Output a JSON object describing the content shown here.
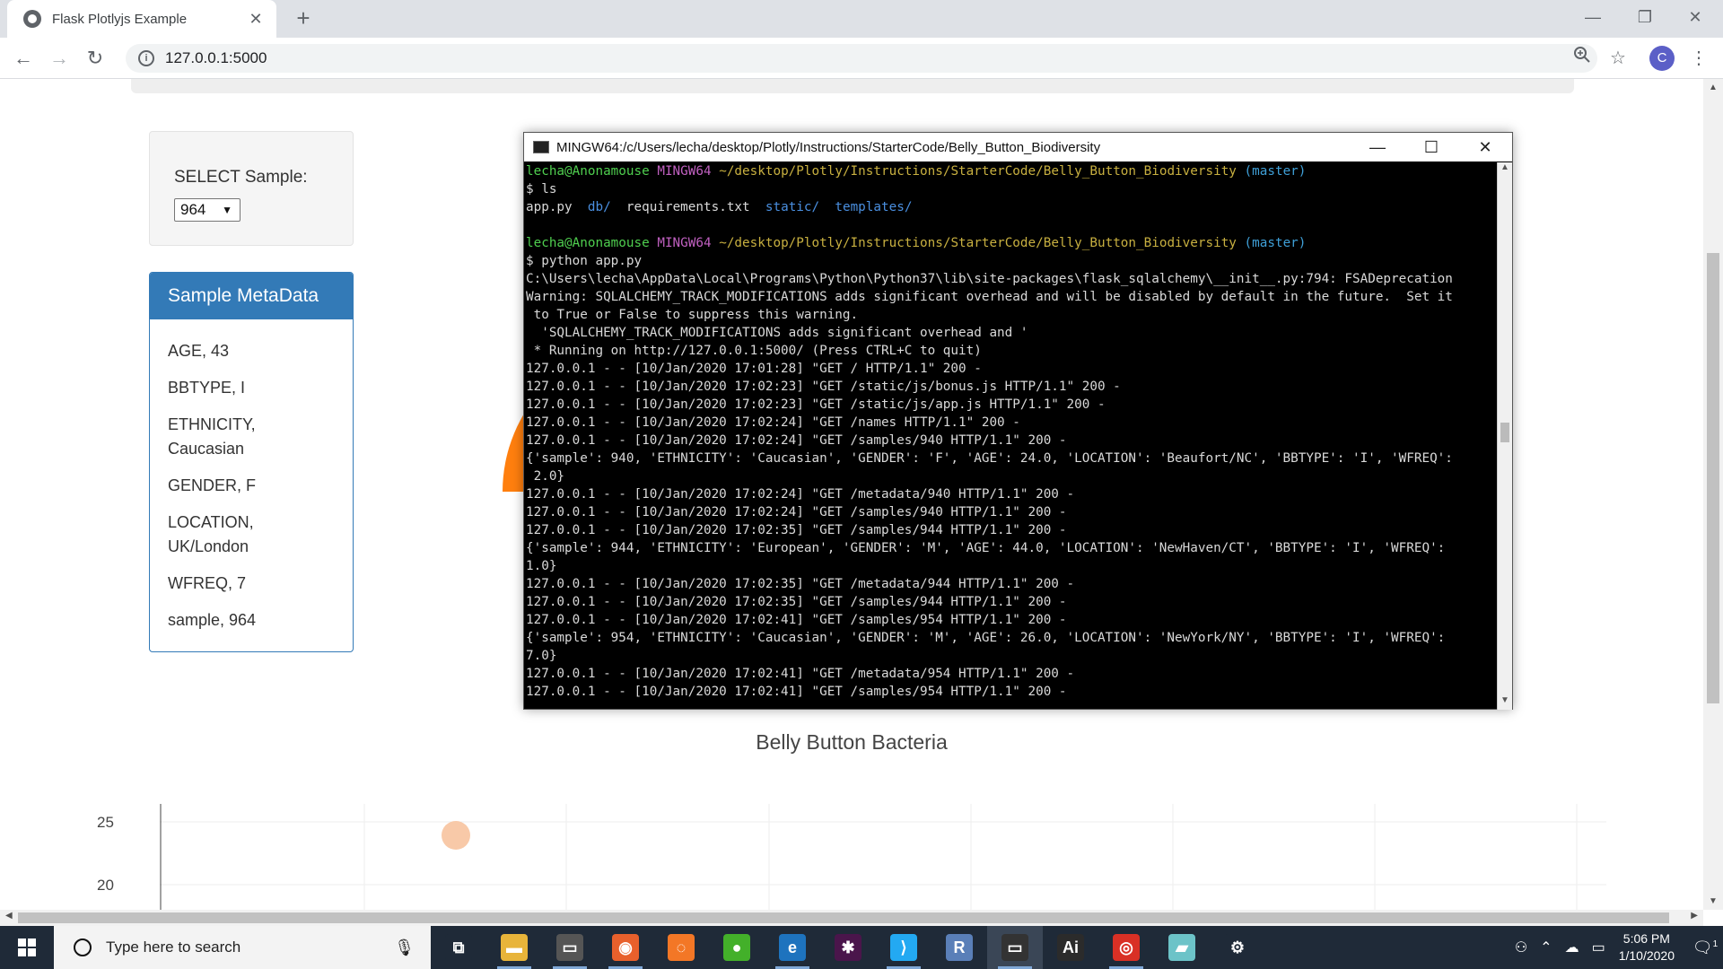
{
  "browser": {
    "tab_title": "Flask Plotlyjs Example",
    "tab_close": "✕",
    "new_tab": "+",
    "url": "127.0.0.1:5000",
    "profile_initial": "C",
    "window_controls": {
      "minimize": "—",
      "restore": "❐",
      "close": "✕"
    },
    "nav": {
      "back": "←",
      "forward": "→",
      "reload": "↻"
    },
    "icons": {
      "zoom": "zoom-icon",
      "star": "star-icon",
      "menu": "⋮"
    }
  },
  "page": {
    "select_label": "SELECT Sample:",
    "select_value": "964",
    "metadata_title": "Sample MetaData",
    "metadata_items": [
      {
        "text": "AGE, 43"
      },
      {
        "text": "BBTYPE, I"
      },
      {
        "text": "ETHNICITY, Caucasian"
      },
      {
        "text": "GENDER, F"
      },
      {
        "text": "LOCATION, UK/London"
      },
      {
        "text": "WFREQ, 7"
      },
      {
        "text": "sample, 964"
      }
    ],
    "bubble_title": "Belly Button Bacteria",
    "bubble_y_ticks": [
      "25",
      "20"
    ]
  },
  "terminal": {
    "title": "MINGW64:/c/Users/lecha/desktop/Plotly/Instructions/StarterCode/Belly_Button_Biodiversity",
    "prompt": {
      "user": "lecha@Anonamouse",
      "host": "MINGW64",
      "path": "~/desktop/Plotly/Instructions/StarterCode/Belly_Button_Biodiversity",
      "branch": "(master)"
    },
    "cmd1": "$ ls",
    "ls_files": [
      "app.py",
      "db/",
      "requirements.txt",
      "static/",
      "templates/"
    ],
    "cmd2": "$ python app.py",
    "lines": [
      "C:\\Users\\lecha\\AppData\\Local\\Programs\\Python\\Python37\\lib\\site-packages\\flask_sqlalchemy\\__init__.py:794: FSADeprecation",
      "Warning: SQLALCHEMY_TRACK_MODIFICATIONS adds significant overhead and will be disabled by default in the future.  Set it",
      " to True or False to suppress this warning.",
      "  'SQLALCHEMY_TRACK_MODIFICATIONS adds significant overhead and '",
      " * Running on http://127.0.0.1:5000/ (Press CTRL+C to quit)",
      "127.0.0.1 - - [10/Jan/2020 17:01:28] \"GET / HTTP/1.1\" 200 -",
      "127.0.0.1 - - [10/Jan/2020 17:02:23] \"GET /static/js/bonus.js HTTP/1.1\" 200 -",
      "127.0.0.1 - - [10/Jan/2020 17:02:23] \"GET /static/js/app.js HTTP/1.1\" 200 -",
      "127.0.0.1 - - [10/Jan/2020 17:02:24] \"GET /names HTTP/1.1\" 200 -",
      "127.0.0.1 - - [10/Jan/2020 17:02:24] \"GET /samples/940 HTTP/1.1\" 200 -",
      "{'sample': 940, 'ETHNICITY': 'Caucasian', 'GENDER': 'F', 'AGE': 24.0, 'LOCATION': 'Beaufort/NC', 'BBTYPE': 'I', 'WFREQ':",
      " 2.0}",
      "127.0.0.1 - - [10/Jan/2020 17:02:24] \"GET /metadata/940 HTTP/1.1\" 200 -",
      "127.0.0.1 - - [10/Jan/2020 17:02:24] \"GET /samples/940 HTTP/1.1\" 200 -",
      "127.0.0.1 - - [10/Jan/2020 17:02:35] \"GET /samples/944 HTTP/1.1\" 200 -",
      "{'sample': 944, 'ETHNICITY': 'European', 'GENDER': 'M', 'AGE': 44.0, 'LOCATION': 'NewHaven/CT', 'BBTYPE': 'I', 'WFREQ':",
      "1.0}",
      "127.0.0.1 - - [10/Jan/2020 17:02:35] \"GET /metadata/944 HTTP/1.1\" 200 -",
      "127.0.0.1 - - [10/Jan/2020 17:02:35] \"GET /samples/944 HTTP/1.1\" 200 -",
      "127.0.0.1 - - [10/Jan/2020 17:02:41] \"GET /samples/954 HTTP/1.1\" 200 -",
      "{'sample': 954, 'ETHNICITY': 'Caucasian', 'GENDER': 'M', 'AGE': 26.0, 'LOCATION': 'NewYork/NY', 'BBTYPE': 'I', 'WFREQ':",
      "7.0}",
      "127.0.0.1 - - [10/Jan/2020 17:02:41] \"GET /metadata/954 HTTP/1.1\" 200 -",
      "127.0.0.1 - - [10/Jan/2020 17:02:41] \"GET /samples/954 HTTP/1.1\" 200 -"
    ],
    "controls": {
      "minimize": "—",
      "maximize": "☐",
      "close": "✕"
    }
  },
  "taskbar": {
    "search_placeholder": "Type here to search",
    "apps": [
      {
        "name": "task-view-icon",
        "glyph": "⧉",
        "color": "#1f2a38"
      },
      {
        "name": "file-explorer-icon",
        "glyph": "▬",
        "color": "#e8b43a"
      },
      {
        "name": "terminal-app-icon",
        "glyph": "▭",
        "color": "#555555"
      },
      {
        "name": "firefox-icon",
        "glyph": "◉",
        "color": "#e8602c"
      },
      {
        "name": "jupyter-icon",
        "glyph": "◌",
        "color": "#f37726"
      },
      {
        "name": "anaconda-icon",
        "glyph": "●",
        "color": "#43b02a"
      },
      {
        "name": "edge-icon",
        "glyph": "e",
        "color": "#1e73be"
      },
      {
        "name": "slack-icon",
        "glyph": "✱",
        "color": "#4a154b"
      },
      {
        "name": "vscode-icon",
        "glyph": "⟩",
        "color": "#23a9f2"
      },
      {
        "name": "r-icon",
        "glyph": "R",
        "color": "#5a7fb8"
      },
      {
        "name": "git-bash-icon",
        "glyph": "▭",
        "color": "#333333"
      },
      {
        "name": "illustrator-icon",
        "glyph": "Ai",
        "color": "#2b2b2b"
      },
      {
        "name": "chrome-icon",
        "glyph": "◎",
        "color": "#d93025"
      },
      {
        "name": "notes-icon",
        "glyph": "▰",
        "color": "#6cc3c8"
      },
      {
        "name": "settings-icon",
        "glyph": "⚙",
        "color": "#1f2a38"
      }
    ],
    "time": "5:06 PM",
    "date": "1/10/2020",
    "notification_count": "1"
  }
}
